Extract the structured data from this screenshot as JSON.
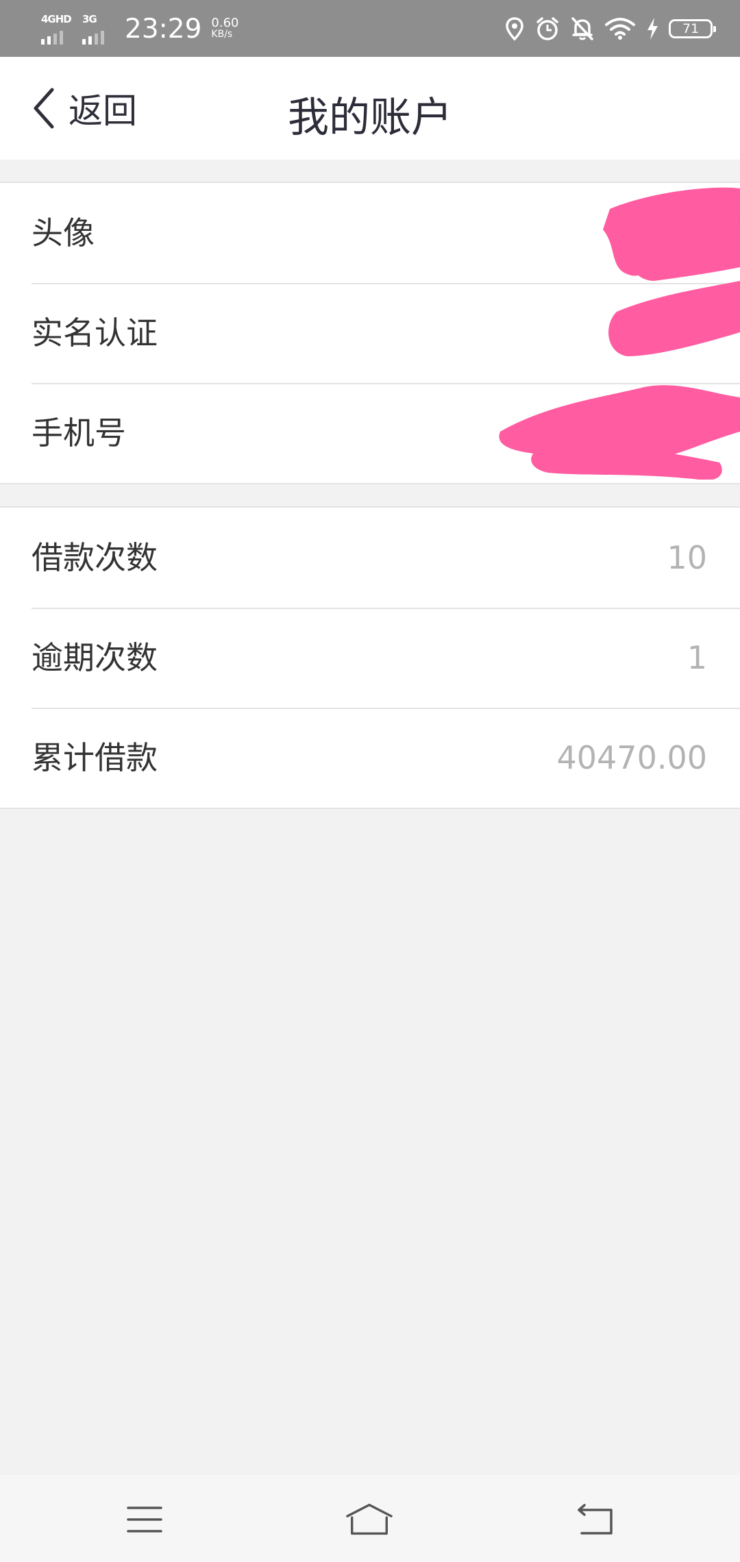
{
  "status_bar": {
    "network_1": "4GHD",
    "network_2": "3G",
    "time": "23:29",
    "speed_value": "0.60",
    "speed_unit": "KB/s",
    "battery": "71",
    "icons": [
      "location-icon",
      "alarm-icon",
      "mute-bell-icon",
      "wifi-icon",
      "charging-icon",
      "battery-icon"
    ]
  },
  "nav": {
    "back_label": "返回",
    "title": "我的账户"
  },
  "profile_group": [
    {
      "label": "头像",
      "value": ""
    },
    {
      "label": "实名认证",
      "value": ""
    },
    {
      "label": "手机号",
      "value": ""
    }
  ],
  "stats_group": [
    {
      "label": "借款次数",
      "value": "10"
    },
    {
      "label": "逾期次数",
      "value": "1"
    },
    {
      "label": "累计借款",
      "value": "40470.00"
    }
  ],
  "redaction_color": "#ff5ca1",
  "bottom_nav": {
    "icons": [
      "menu-icon",
      "home-icon",
      "back-arrow-icon"
    ]
  }
}
